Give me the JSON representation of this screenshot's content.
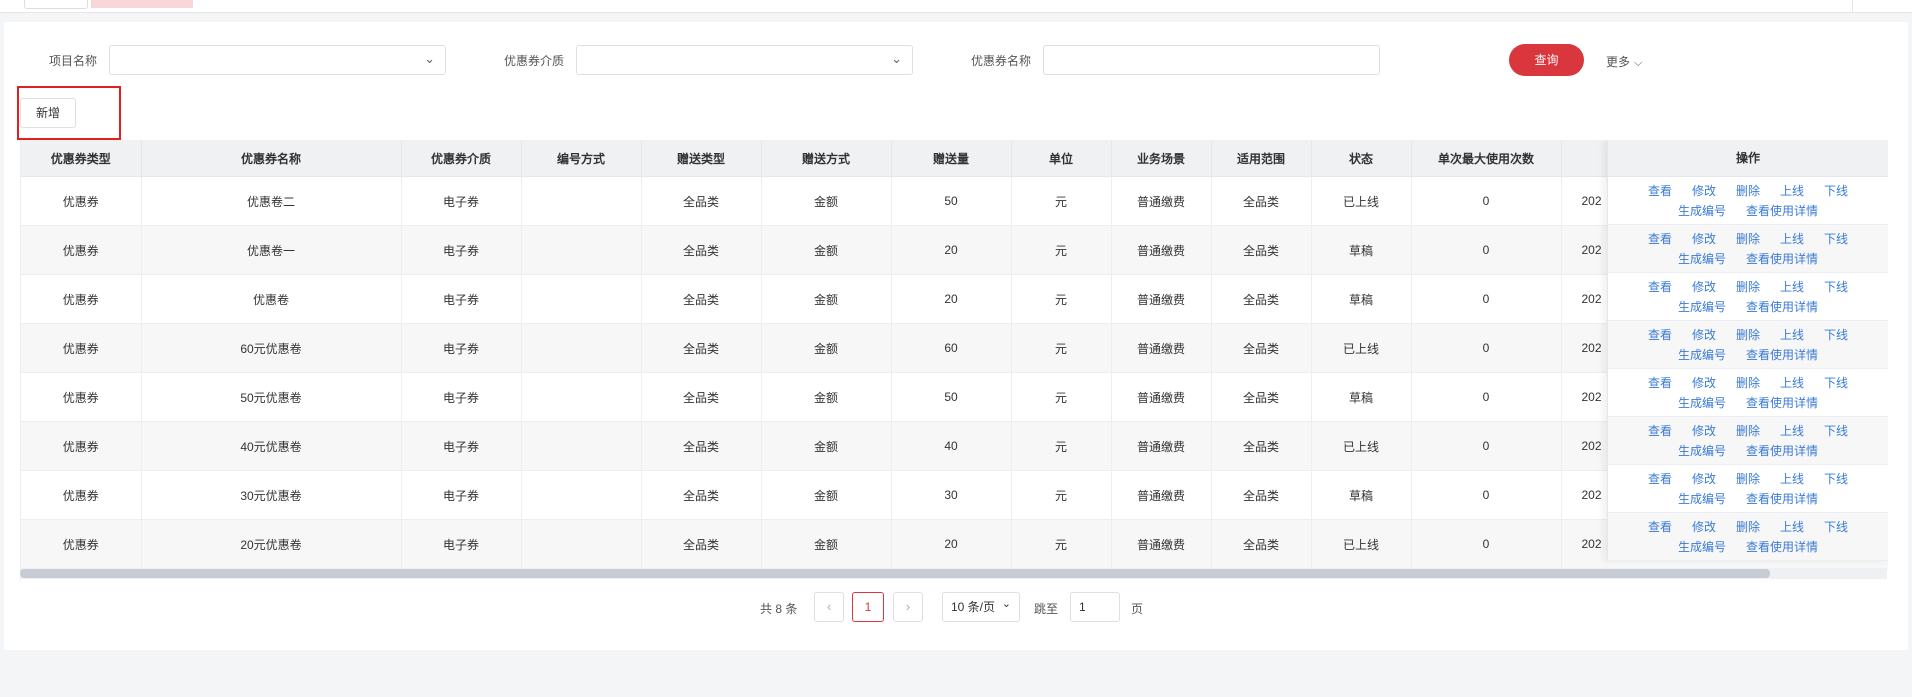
{
  "filters": {
    "project_label": "项目名称",
    "medium_label": "优惠券介质",
    "name_label": "优惠券名称",
    "query_label": "查询",
    "more_label": "更多"
  },
  "toolbar": {
    "add_label": "新增"
  },
  "table": {
    "columns": [
      "优惠券类型",
      "优惠券名称",
      "优惠券介质",
      "编号方式",
      "赠送类型",
      "赠送方式",
      "赠送量",
      "单位",
      "业务场景",
      "适用范围",
      "状态",
      "单次最大使用次数",
      ""
    ],
    "op_header": "操作",
    "rows": [
      [
        "优惠券",
        "优惠卷二",
        "电子券",
        "",
        "全品类",
        "金额",
        "50",
        "元",
        "普通缴费",
        "全品类",
        "已上线",
        "0",
        "202"
      ],
      [
        "优惠券",
        "优惠卷一",
        "电子券",
        "",
        "全品类",
        "金额",
        "20",
        "元",
        "普通缴费",
        "全品类",
        "草稿",
        "0",
        "202"
      ],
      [
        "优惠券",
        "优惠卷",
        "电子券",
        "",
        "全品类",
        "金额",
        "20",
        "元",
        "普通缴费",
        "全品类",
        "草稿",
        "0",
        "202"
      ],
      [
        "优惠券",
        "60元优惠卷",
        "电子券",
        "",
        "全品类",
        "金额",
        "60",
        "元",
        "普通缴费",
        "全品类",
        "已上线",
        "0",
        "202"
      ],
      [
        "优惠券",
        "50元优惠卷",
        "电子券",
        "",
        "全品类",
        "金额",
        "50",
        "元",
        "普通缴费",
        "全品类",
        "草稿",
        "0",
        "202"
      ],
      [
        "优惠券",
        "40元优惠卷",
        "电子券",
        "",
        "全品类",
        "金额",
        "40",
        "元",
        "普通缴费",
        "全品类",
        "已上线",
        "0",
        "202"
      ],
      [
        "优惠券",
        "30元优惠卷",
        "电子券",
        "",
        "全品类",
        "金额",
        "30",
        "元",
        "普通缴费",
        "全品类",
        "草稿",
        "0",
        "202"
      ],
      [
        "优惠券",
        "20元优惠卷",
        "电子券",
        "",
        "全品类",
        "金额",
        "20",
        "元",
        "普通缴费",
        "全品类",
        "已上线",
        "0",
        "202"
      ]
    ],
    "actions_line1": [
      "查看",
      "修改",
      "删除",
      "上线",
      "下线"
    ],
    "actions_line2": [
      "生成编号",
      "查看使用详情"
    ]
  },
  "pagination": {
    "total_label": "共 8 条",
    "prev": "‹",
    "current_page": "1",
    "next": "›",
    "page_size": "10 条/页",
    "jump_label": "跳至",
    "jump_value": "1",
    "page_suffix": "页"
  },
  "icons": {
    "chevron": "chevron-down-icon"
  },
  "colors": {
    "accent": "#d9363e",
    "link": "#3a7bd5",
    "highlight": "#e02020"
  }
}
